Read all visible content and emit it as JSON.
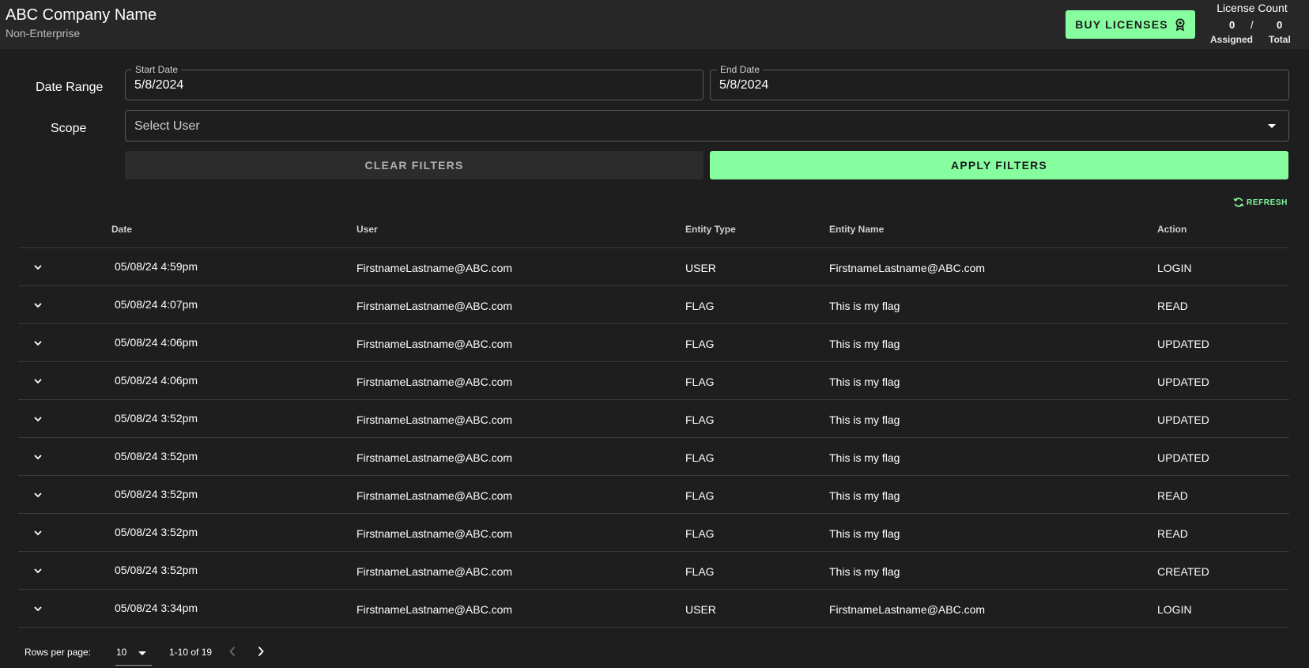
{
  "header": {
    "company_name": "ABC Company Name",
    "company_subtitle": "Non-Enterprise",
    "buy_label": "BUY LICENSES",
    "license": {
      "title": "License Count",
      "assigned": "0",
      "separator": "/",
      "total": "0",
      "assigned_label": "Assigned",
      "total_label": "Total"
    }
  },
  "filters": {
    "date_range_label": "Date Range",
    "scope_label": "Scope",
    "start_date": {
      "legend": "Start Date",
      "value": "5/8/2024"
    },
    "end_date": {
      "legend": "End Date",
      "value": "5/8/2024"
    },
    "scope_select": {
      "placeholder": "Select User"
    },
    "clear_label": "CLEAR FILTERS",
    "apply_label": "APPLY FILTERS"
  },
  "refresh_label": "REFRESH",
  "table": {
    "columns": [
      "Date",
      "User",
      "Entity Type",
      "Entity Name",
      "Action"
    ],
    "rows": [
      {
        "date": "05/08/24 4:59pm",
        "user": "FirstnameLastname@ABC.com",
        "entity_type": "USER",
        "entity_name": "FirstnameLastname@ABC.com",
        "action": "LOGIN"
      },
      {
        "date": "05/08/24 4:07pm",
        "user": "FirstnameLastname@ABC.com",
        "entity_type": "FLAG",
        "entity_name": "This is my flag",
        "action": "READ"
      },
      {
        "date": "05/08/24 4:06pm",
        "user": "FirstnameLastname@ABC.com",
        "entity_type": "FLAG",
        "entity_name": "This is my flag",
        "action": "UPDATED"
      },
      {
        "date": "05/08/24 4:06pm",
        "user": "FirstnameLastname@ABC.com",
        "entity_type": "FLAG",
        "entity_name": "This is my flag",
        "action": "UPDATED"
      },
      {
        "date": "05/08/24 3:52pm",
        "user": "FirstnameLastname@ABC.com",
        "entity_type": "FLAG",
        "entity_name": "This is my flag",
        "action": "UPDATED"
      },
      {
        "date": "05/08/24 3:52pm",
        "user": "FirstnameLastname@ABC.com",
        "entity_type": "FLAG",
        "entity_name": "This is my flag",
        "action": "UPDATED"
      },
      {
        "date": "05/08/24 3:52pm",
        "user": "FirstnameLastname@ABC.com",
        "entity_type": "FLAG",
        "entity_name": "This is my flag",
        "action": "READ"
      },
      {
        "date": "05/08/24 3:52pm",
        "user": "FirstnameLastname@ABC.com",
        "entity_type": "FLAG",
        "entity_name": "This is my flag",
        "action": "READ"
      },
      {
        "date": "05/08/24 3:52pm",
        "user": "FirstnameLastname@ABC.com",
        "entity_type": "FLAG",
        "entity_name": "This is my flag",
        "action": "CREATED"
      },
      {
        "date": "05/08/24 3:34pm",
        "user": "FirstnameLastname@ABC.com",
        "entity_type": "USER",
        "entity_name": "FirstnameLastname@ABC.com",
        "action": "LOGIN"
      }
    ]
  },
  "pagination": {
    "rows_per_page_label": "Rows per page:",
    "rows_per_page_value": "10",
    "range_text": "1-10 of 19"
  },
  "colors": {
    "accent": "#86fd9f",
    "background": "#1e1e1e",
    "header": "#272727"
  },
  "icons": {
    "buy": "award-ribbon-icon",
    "refresh": "refresh-icon",
    "row_expand": "chevron-down-icon",
    "prev": "chevron-left-icon",
    "next": "chevron-right-icon"
  }
}
